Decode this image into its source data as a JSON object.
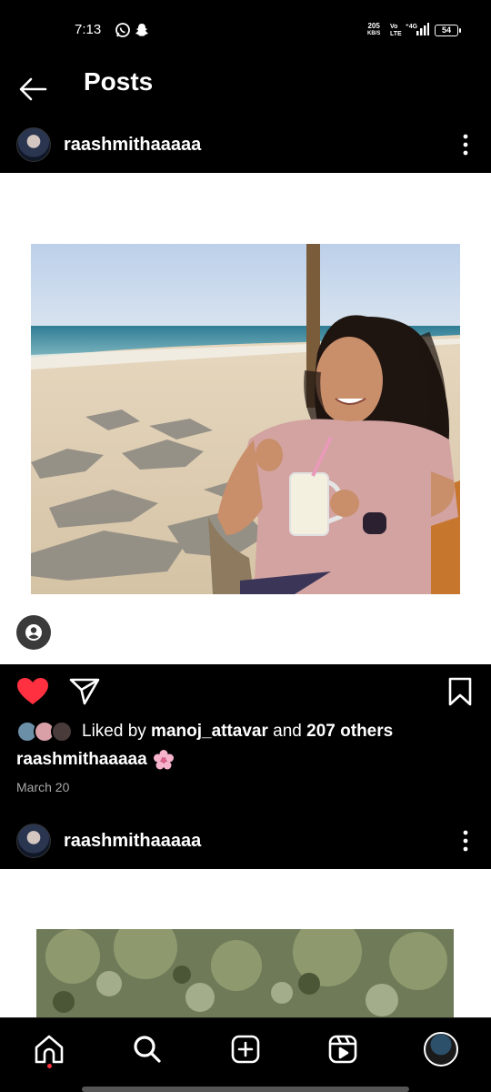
{
  "status_bar": {
    "time": "7:13",
    "net_speed_value": "205",
    "net_speed_unit": "KB/S",
    "volte_top": "Vo",
    "volte_bottom": "LTE",
    "network": "4G",
    "battery": "54",
    "icons": [
      "whatsapp-icon",
      "snapchat-icon",
      "signal-icon",
      "battery-icon"
    ]
  },
  "header": {
    "title": "Posts",
    "back_icon": "arrow-left-icon"
  },
  "posts": [
    {
      "username": "raashmithaaaaa",
      "liked_by_prefix": "Liked by ",
      "liked_by_user": "manoj_attavar",
      "liked_by_and": " and ",
      "liked_by_others": "207 others",
      "caption_user": "raashmithaaaaa",
      "caption_emoji": "cherry-blossom",
      "date": "March 20"
    },
    {
      "username": "raashmithaaaaa"
    }
  ],
  "bottom_nav": [
    "home-icon",
    "search-icon",
    "create-icon",
    "reels-icon",
    "profile-avatar"
  ],
  "colors": {
    "background": "#000000",
    "like_red": "#ff3040",
    "media_bg": "#ffffff",
    "secondary_text": "#a8a8a8"
  }
}
